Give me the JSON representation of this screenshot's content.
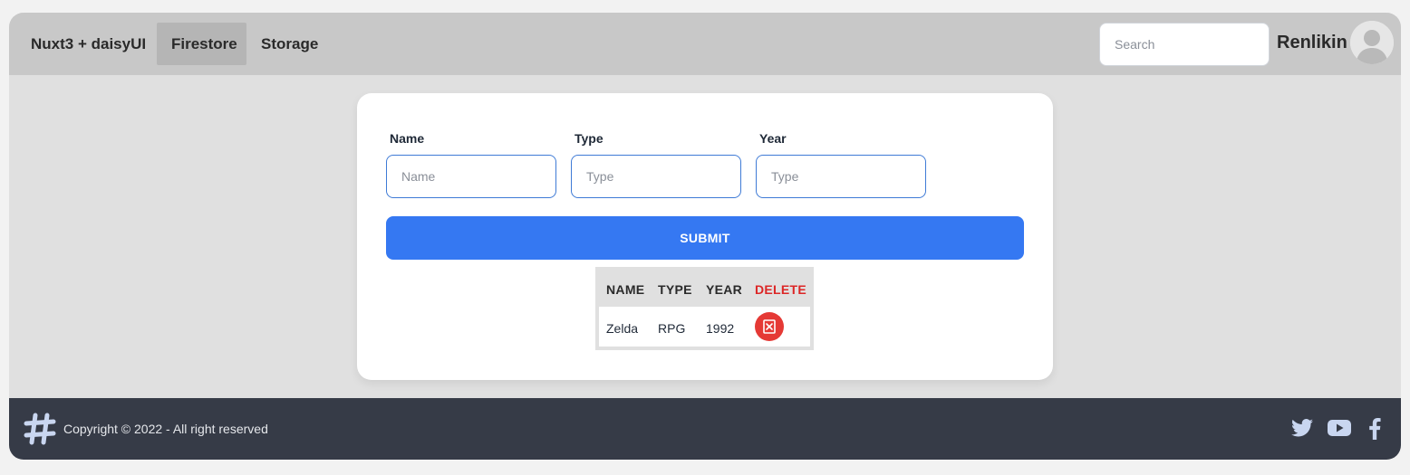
{
  "navbar": {
    "brand": "Nuxt3 + daisyUI",
    "items": [
      {
        "label": "Firestore",
        "active": true
      },
      {
        "label": "Storage",
        "active": false
      }
    ],
    "search_placeholder": "Search",
    "username": "Renlikin",
    "avatar_icon": "user-avatar-icon"
  },
  "form": {
    "fields": [
      {
        "label": "Name",
        "placeholder": "Name",
        "value": ""
      },
      {
        "label": "Type",
        "placeholder": "Type",
        "value": ""
      },
      {
        "label": "Year",
        "placeholder": "Type",
        "value": ""
      }
    ],
    "submit_label": "SUBMIT"
  },
  "table": {
    "headers": [
      "NAME",
      "TYPE",
      "YEAR",
      "DELETE"
    ],
    "rows": [
      {
        "name": "Zelda",
        "type": "RPG",
        "year": "1992"
      }
    ],
    "delete_icon": "delete-x-icon"
  },
  "footer": {
    "logo_icon": "hashtag-logo-icon",
    "copyright": "Copyright © 2022 - All right reserved",
    "social_icons": [
      "twitter-icon",
      "youtube-icon",
      "facebook-icon"
    ]
  },
  "colors": {
    "primary": "#3578f2",
    "danger": "#dc2626",
    "navbar_bg": "#c8c8c8",
    "footer_bg": "#363b47",
    "page_bg": "#e0e0e0"
  }
}
